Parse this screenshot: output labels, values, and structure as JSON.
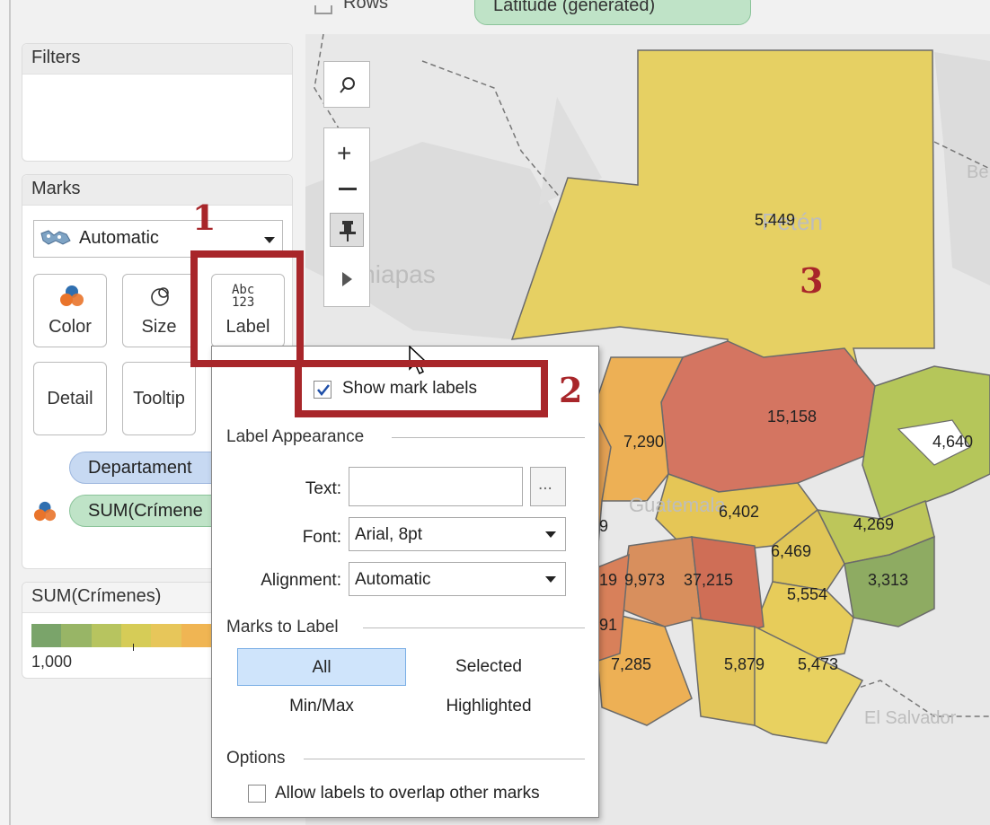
{
  "shelf": {
    "rows_label": "Rows",
    "rows_pill": "Latitude (generated)"
  },
  "filters": {
    "title": "Filters"
  },
  "marks": {
    "title": "Marks",
    "mark_type": "Automatic",
    "cards": {
      "color": "Color",
      "size": "Size",
      "label": "Label",
      "label_icon_text": "Abc\n123",
      "detail": "Detail",
      "tooltip": "Tooltip"
    },
    "pills": [
      "Departament",
      "SUM(Crímene"
    ]
  },
  "legend": {
    "title": "SUM(Crímenes)",
    "min_label": "1,000",
    "colors": [
      "#7aa46a",
      "#98b566",
      "#b7c45f",
      "#d6cc57",
      "#e7c65a",
      "#f0b553"
    ]
  },
  "annotations": {
    "one": "1",
    "two": "2",
    "three": "3",
    "color": "#a8262a"
  },
  "popup": {
    "show_mark_labels": "Show mark labels",
    "show_mark_labels_checked": true,
    "label_appearance": "Label Appearance",
    "text_label": "Text:",
    "text_value": "",
    "ellipsis": "...",
    "font_label": "Font:",
    "font_value": "Arial, 8pt",
    "alignment_label": "Alignment:",
    "alignment_value": "Automatic",
    "marks_to_label": "Marks to Label",
    "options_marks": [
      "All",
      "Selected",
      "Min/Max",
      "Highlighted"
    ],
    "selected_option": "All",
    "options": "Options",
    "allow_overlap": "Allow labels to overlap other marks",
    "allow_overlap_checked": false
  },
  "map": {
    "places": [
      "Chiapas",
      "Petén",
      "Guatemala",
      "El Salvador",
      "Be"
    ],
    "values": {
      "peten": "5,449",
      "alta_verapaz": "15,158",
      "izabal": "4,640",
      "quiche": "7,290",
      "el_progreso": "6,402",
      "zacapa": "4,269",
      "jalapa": "6,469",
      "chiquimula": "3,313",
      "jutiapa": "5,554",
      "sacatepequez": "9,973",
      "guatemala": "37,215",
      "escuintla": "7,285",
      "santa_rosa": "5,879",
      "jutiapa_s": "5,473",
      "partial_a": "19",
      "partial_b": "9",
      "partial_c": "91"
    }
  }
}
